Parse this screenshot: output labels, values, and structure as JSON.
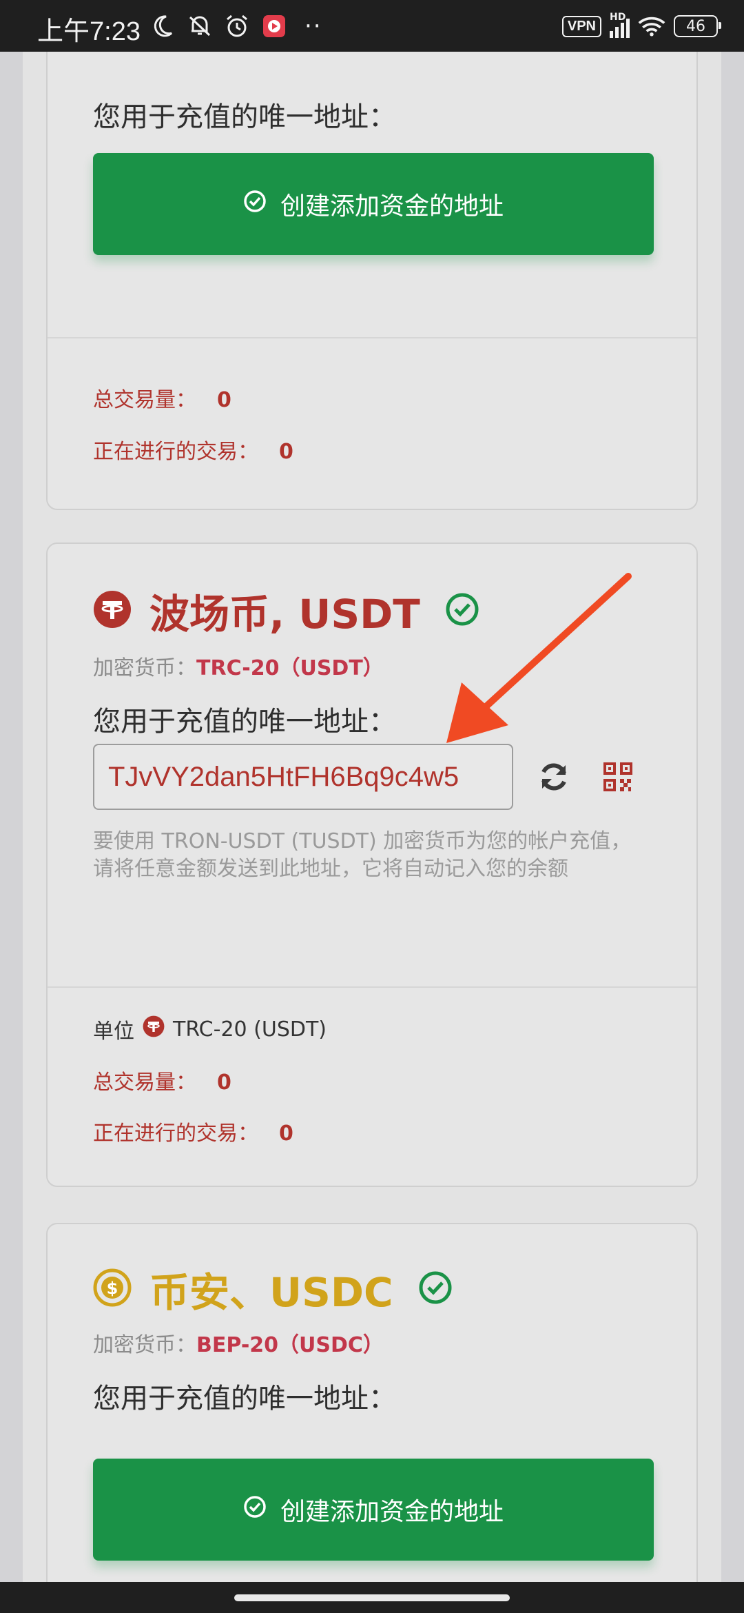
{
  "status_bar": {
    "time": "上午7:23",
    "icons": [
      "moon-icon",
      "mute-icon",
      "alarm-icon",
      "app-notification-icon"
    ],
    "more": "··",
    "vpn": "VPN",
    "network": "HD",
    "battery": "46"
  },
  "colors": {
    "accent_green": "#1a9247",
    "danger_red": "#b0332c",
    "tether_red": "#b0332c",
    "usdc_gold": "#d1a31b",
    "arrow": "#f04a23"
  },
  "card1": {
    "unique_label": "您用于充值的唯一地址：",
    "create_button": "创建添加资金的地址",
    "total_label": "总交易量：",
    "total_value": "0",
    "ongoing_label": "正在进行的交易：",
    "ongoing_value": "0"
  },
  "card2": {
    "title": "波场币, USDT",
    "crypto_label": "加密货币：",
    "crypto_value": "TRC-20（USDT）",
    "unique_label": "您用于充值的唯一地址：",
    "address": "TJvVY2dan5HtFH6Bq9c4w5",
    "help": "要使用 TRON-USDT (TUSDT) 加密货币为您的帐户充值，请将任意金额发送到此地址，它将自动记入您的余额",
    "unit_label": "单位",
    "unit_value": "TRC-20 (USDT)",
    "total_label": "总交易量：",
    "total_value": "0",
    "ongoing_label": "正在进行的交易：",
    "ongoing_value": "0"
  },
  "card3": {
    "title": "币安、USDC",
    "crypto_label": "加密货币：",
    "crypto_value": "BEP-20（USDC）",
    "unique_label": "您用于充值的唯一地址：",
    "create_button": "创建添加资金的地址"
  }
}
